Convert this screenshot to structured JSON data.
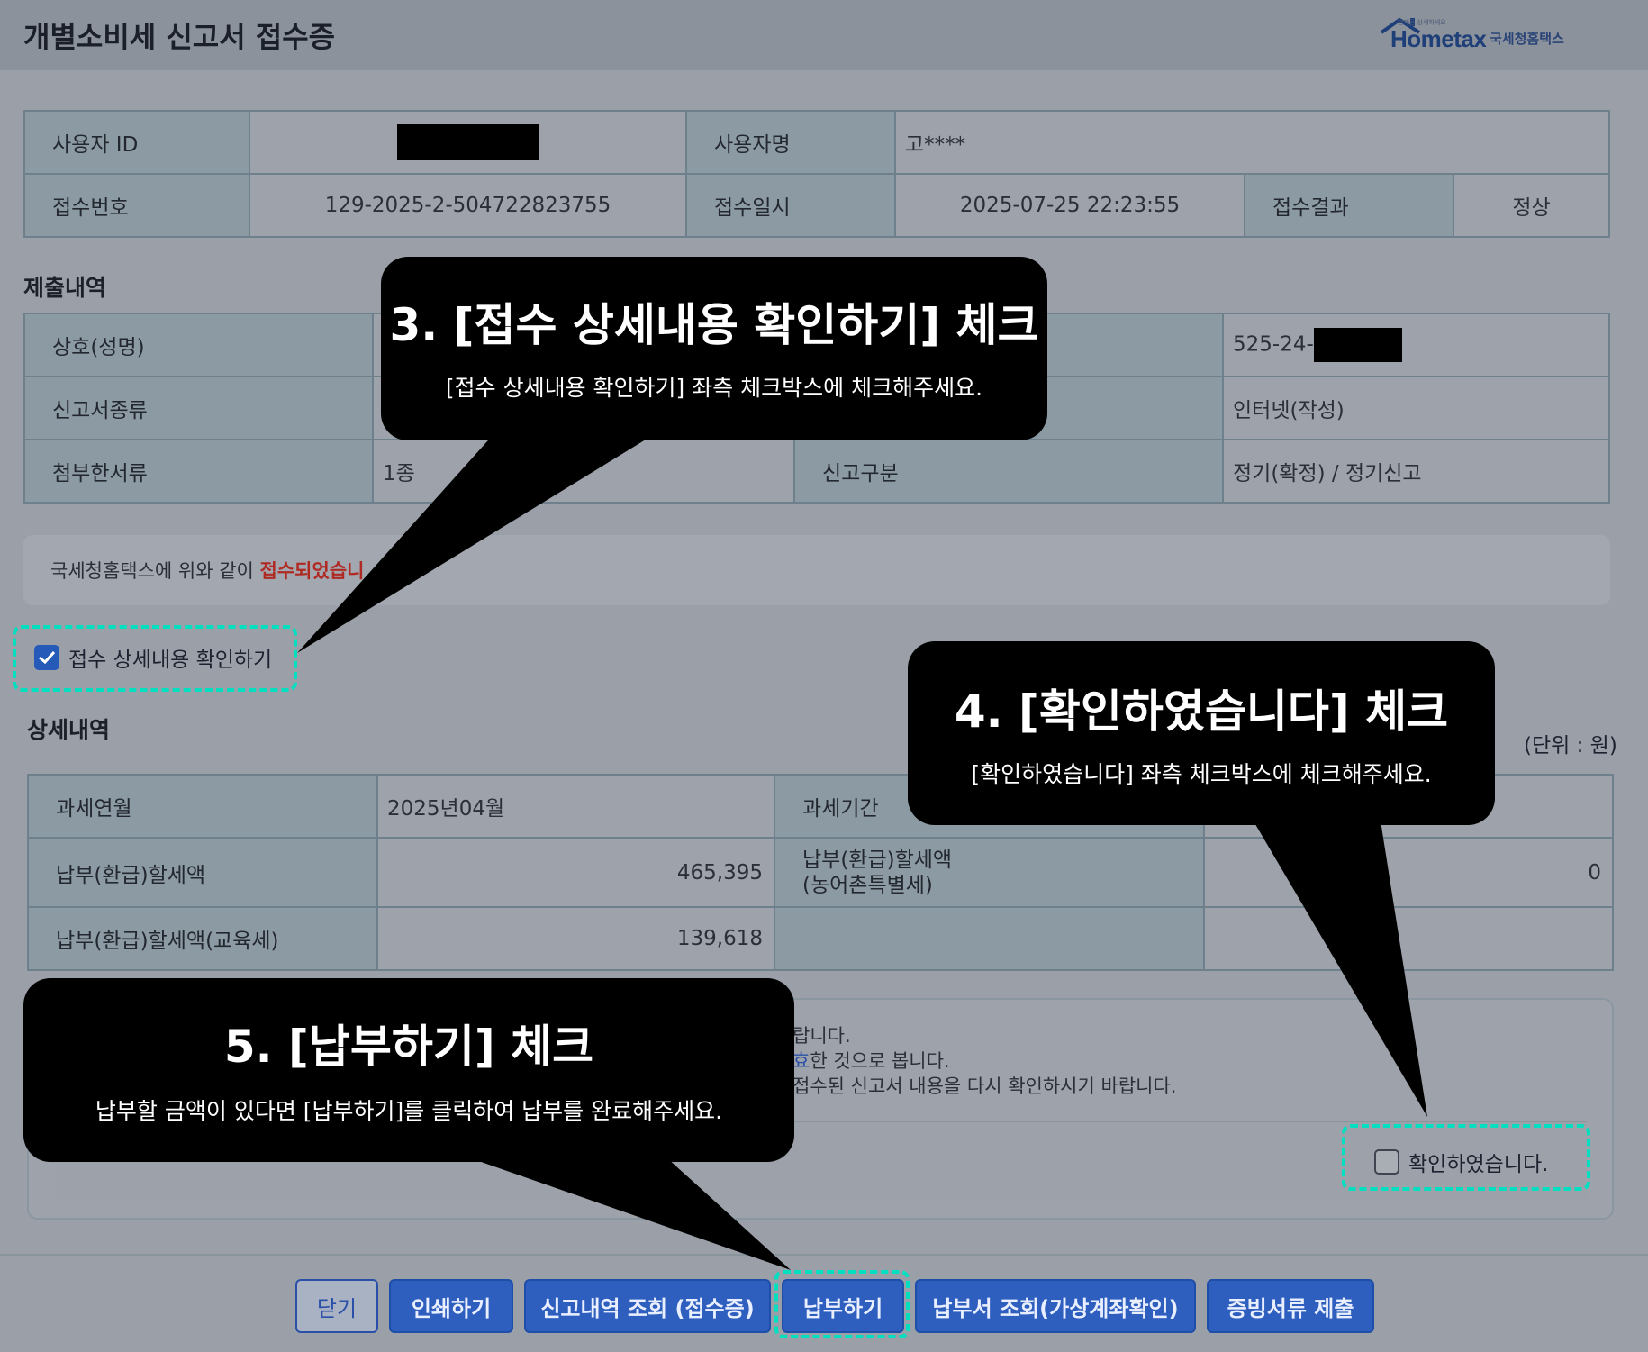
{
  "header": {
    "title": "개별소비세 신고서 접수증",
    "logo_brand": "Hometax",
    "logo_tagline": "언제든 상세하세요",
    "logo_org": "국세청홈택스"
  },
  "info": {
    "user_id_label": "사용자 ID",
    "user_name_label": "사용자명",
    "user_name": "고****",
    "receipt_no_label": "접수번호",
    "receipt_no": "129-2025-2-504722823755",
    "receipt_time_label": "접수일시",
    "receipt_time": "2025-07-25 22:23:55",
    "result_label": "접수결과",
    "result": "정상"
  },
  "submission": {
    "section": "제출내역",
    "business_name_label": "상호(성명)",
    "biz_no_partial": "525-24-",
    "report_type_label": "신고서종류",
    "method": "인터넷(작성)",
    "attached_label": "첨부한서류",
    "attached": "1종",
    "category_label": "신고구분",
    "category": "정기(확정) / 정기신고"
  },
  "notice": {
    "prefix": "국세청홈택스에 위와 같이 ",
    "highlight": "접수되었습니"
  },
  "detail_toggle": {
    "label": "접수 상세내용 확인하기",
    "checked": true
  },
  "details": {
    "section": "상세내역",
    "unit": "(단위 : 원)",
    "tax_month_label": "과세연월",
    "tax_month": "2025년04월",
    "tax_period_label": "과세기간",
    "payable_label": "납부(환급)할세액",
    "payable": "465,395",
    "payable_farm_label_1": "납부(환급)할세액",
    "payable_farm_label_2": "(농어촌특별세)",
    "payable_farm": "0",
    "payable_edu_label": "납부(환급)할세액(교육세)",
    "payable_edu": "139,618"
  },
  "confirm": {
    "line1": "랍니다.",
    "line2_blue": "효",
    "line2_rest": "한 것으로 봅니다.",
    "line3": "접수된 신고서 내용을 다시 확인하시기 바랍니다.",
    "checkbox_label": "확인하였습니다.",
    "checked": false
  },
  "buttons": {
    "close": "닫기",
    "print": "인쇄하기",
    "history": "신고내역 조회 (접수증)",
    "pay": "납부하기",
    "bill": "납부서 조회(가상계좌확인)",
    "evidence": "증빙서류 제출"
  },
  "callouts": {
    "c3_title": "3. [접수 상세내용 확인하기] 체크",
    "c3_sub": "[접수 상세내용 확인하기] 좌측 체크박스에 체크해주세요.",
    "c4_title": "4. [확인하였습니다] 체크",
    "c4_sub": "[확인하였습니다] 좌측 체크박스에 체크해주세요.",
    "c5_title": "5. [납부하기] 체크",
    "c5_sub": "납부할 금액이 있다면 [납부하기]를 클릭하여 납부를 완료해주세요."
  },
  "colors": {
    "overlay_bg": "#9a9fa8",
    "button_blue": "#2e5fbf",
    "highlight_dash": "#00e0c0",
    "notice_red": "#b02a24"
  }
}
